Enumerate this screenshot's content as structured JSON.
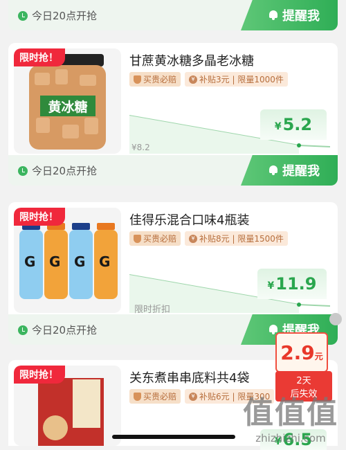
{
  "items": [
    {
      "time": "今日20点开抢",
      "remind": "提醒我"
    },
    {
      "flash": "限时抢！",
      "jar_label": "黄冰糖",
      "title": "甘蔗黄冰糖多晶老冰糖",
      "guarantee": "买贵必赔",
      "subsidy": "补贴3元 | 限量1000件",
      "orig_price": "¥8.2",
      "price": "5.2",
      "time": "今日20点开抢",
      "remind": "提醒我"
    },
    {
      "flash": "限时抢！",
      "title": "佳得乐混合口味4瓶装",
      "guarantee": "买贵必赔",
      "subsidy": "补贴8元 | 限量1500件",
      "orig_price": "限时折扣",
      "price": "11.9",
      "time": "今日20点开抢",
      "remind": "提醒我"
    },
    {
      "flash": "限时抢！",
      "title": "关东煮串串底料共4袋",
      "guarantee": "买贵必赔",
      "subsidy": "补贴6元 | 限量300",
      "price": "6.5"
    }
  ],
  "float_badge": {
    "price": "2.9",
    "unit": "元",
    "line1": "2天",
    "line2": "后失效"
  },
  "currency": "¥",
  "watermark": {
    "logo": "值值值",
    "url": "zhizhizhi.com"
  }
}
